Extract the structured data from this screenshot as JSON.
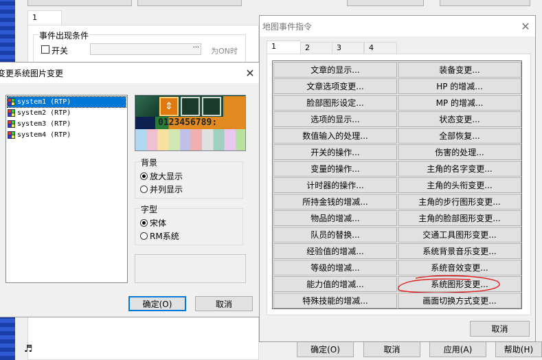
{
  "background": {
    "tab_label": "1",
    "group_label": "事件出现条件",
    "switch_label": "开关",
    "switch_suffix": "为ON时",
    "bottom_buttons": [
      "确定(O)",
      "取消",
      "应用(A)",
      "帮助(H)"
    ]
  },
  "graphic_dialog": {
    "title": "变更系统图片变更",
    "list_items": [
      "system1 (RTP)",
      "system2 (RTP)",
      "system3 (RTP)",
      "system4 (RTP)"
    ],
    "selected_index": 0,
    "preview_digits": "0123456789:",
    "bg_group": {
      "label": "背景",
      "options": [
        "放大显示",
        "并列显示"
      ],
      "selected": 0
    },
    "font_group": {
      "label": "字型",
      "options": [
        "宋体",
        "RM系统"
      ],
      "selected": 0
    },
    "ok_label": "确定(O)",
    "cancel_label": "取消"
  },
  "event_dialog": {
    "title": "地图事件指令",
    "tabs": [
      "1",
      "2",
      "3",
      "4"
    ],
    "active_tab": 0,
    "commands_left": [
      "文章的显示...",
      "文章选项变更...",
      "脸部图形设定...",
      "选项的显示...",
      "数值输入的处理...",
      "开关的操作...",
      "变量的操作...",
      "计时器的操作...",
      "所持金钱的增减...",
      "物品的增减...",
      "队员的替换...",
      "经验值的增减...",
      "等级的增减...",
      "能力值的增减...",
      "特殊技能的增减..."
    ],
    "commands_right": [
      "装备变更...",
      "HP 的增减...",
      "MP 的增减...",
      "状态变更...",
      "全部恢复...",
      "伤害的处理...",
      "主角的名字变更...",
      "主角的头衔变更...",
      "主角的步行图形变更...",
      "主角的脸部图形变更...",
      "交通工具图形变更...",
      "系统背景音乐变更...",
      "系统音效变更...",
      "系统图形变更...",
      "画面切换方式变更..."
    ],
    "highlighted": "系统图形变更...",
    "highlight_color": "#e02020",
    "cancel_label": "取消"
  }
}
